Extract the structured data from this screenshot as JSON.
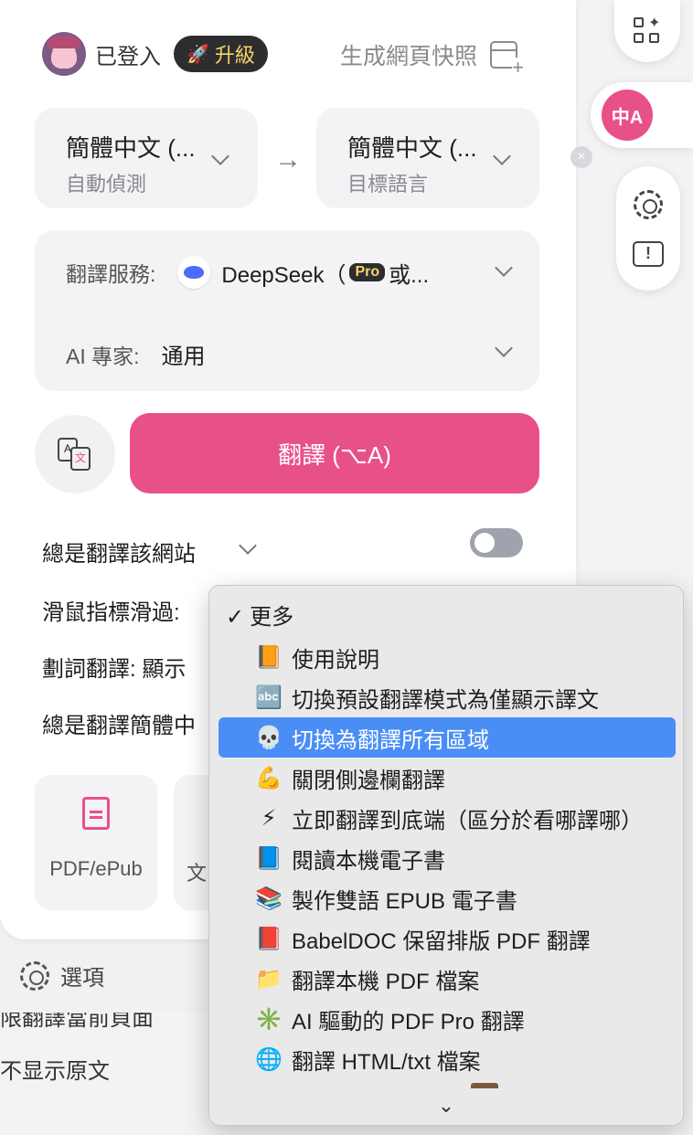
{
  "header": {
    "logged_in": "已登入",
    "upgrade": "升級",
    "snapshot": "生成網頁快照"
  },
  "languages": {
    "source": {
      "name": "簡體中文 (...",
      "sub": "自動偵測"
    },
    "target": {
      "name": "簡體中文 (...",
      "sub": "目標語言"
    }
  },
  "service": {
    "label": "翻譯服務:",
    "value": "DeepSeek（",
    "pro_badge": "Pro",
    "suffix": "或...",
    "expert_label": "AI 專家:",
    "expert_value": "通用"
  },
  "translate_button": "翻譯 (⌥A)",
  "options": {
    "always_site": "總是翻譯該網站",
    "hover": "滑鼠指標滑過:",
    "selection": "劃詞翻譯: 顯示",
    "always_lang": "總是翻譯簡體中"
  },
  "tiles": [
    {
      "label": "PDF/ePub"
    },
    {
      "label": "文"
    }
  ],
  "footer": {
    "options": "選項"
  },
  "background_text": [
    "限翻譯當前頁面",
    "不显示原文"
  ],
  "menu": {
    "header_check": "✓",
    "header": "更多",
    "items": [
      {
        "icon": "📙",
        "label": "使用說明"
      },
      {
        "icon": "🔤",
        "label": "切換預設翻譯模式為僅顯示譯文"
      },
      {
        "icon": "💀",
        "label": "切換為翻譯所有區域",
        "selected": true
      },
      {
        "icon": "💪",
        "label": "關閉側邊欄翻譯"
      },
      {
        "icon": "⚡",
        "label": "立即翻譯到底端（區分於看哪譯哪）"
      },
      {
        "icon": "📘",
        "label": "閱讀本機電子書"
      },
      {
        "icon": "📚",
        "label": "製作雙語 EPUB 電子書"
      },
      {
        "icon": "📕",
        "label": "BabelDOC 保留排版 PDF 翻譯"
      },
      {
        "icon": "📁",
        "label": "翻譯本機 PDF 檔案"
      },
      {
        "icon": "✳️",
        "label": "AI 驅動的 PDF Pro 翻譯"
      },
      {
        "icon": "🌐",
        "label": "翻譯 HTML/txt 檔案"
      }
    ],
    "more_arrow": "⌄"
  },
  "colors": {
    "accent": "#e8508a",
    "selection": "#4a8ef5",
    "pro_bg": "#2d2d2f",
    "pro_text": "#f6d36b"
  }
}
